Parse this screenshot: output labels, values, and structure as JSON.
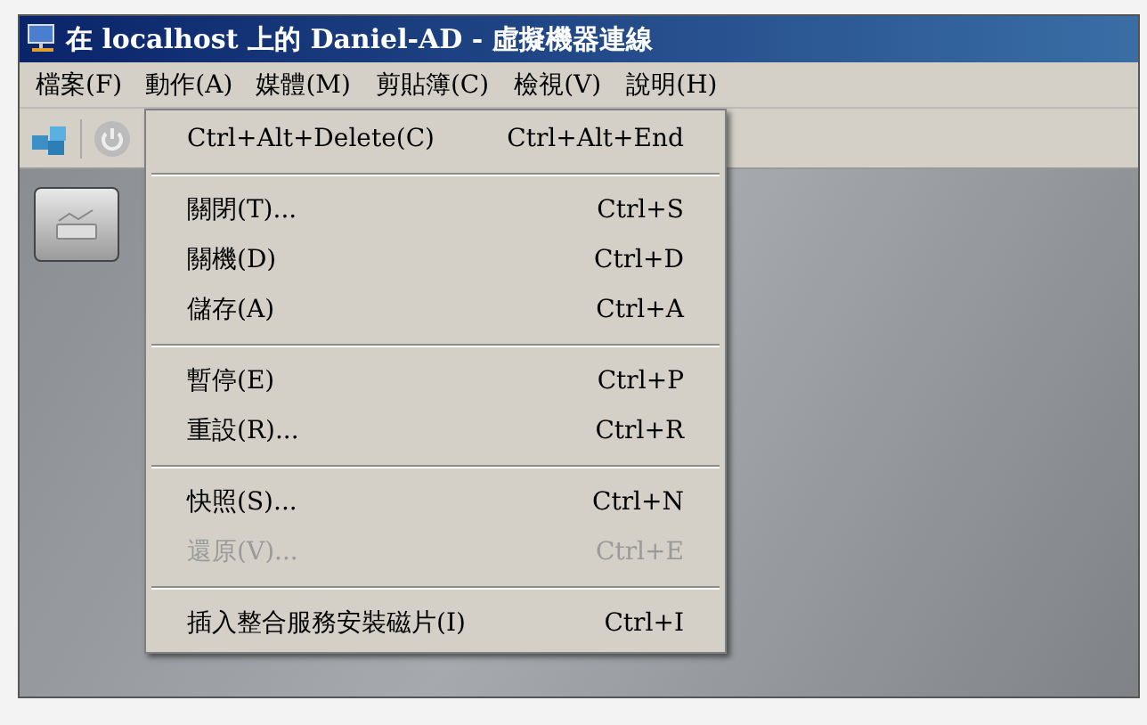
{
  "window": {
    "title": "在 localhost 上的 Daniel-AD - 虛擬機器連線"
  },
  "menu_bar": [
    {
      "label": "檔案(F)",
      "selected": false
    },
    {
      "label": "動作(A)",
      "selected": true
    },
    {
      "label": "媒體(M)",
      "selected": false
    },
    {
      "label": "剪貼簿(C)",
      "selected": false
    },
    {
      "label": "檢視(V)",
      "selected": false
    },
    {
      "label": "說明(H)",
      "selected": false
    }
  ],
  "dropdown": {
    "groups": [
      [
        {
          "label": "Ctrl+Alt+Delete(C)",
          "shortcut": "Ctrl+Alt+End",
          "disabled": false
        }
      ],
      [
        {
          "label": "關閉(T)...",
          "shortcut": "Ctrl+S",
          "disabled": false
        },
        {
          "label": "關機(D)",
          "shortcut": "Ctrl+D",
          "disabled": false
        },
        {
          "label": "儲存(A)",
          "shortcut": "Ctrl+A",
          "disabled": false
        }
      ],
      [
        {
          "label": "暫停(E)",
          "shortcut": "Ctrl+P",
          "disabled": false
        },
        {
          "label": "重設(R)...",
          "shortcut": "Ctrl+R",
          "disabled": false
        }
      ],
      [
        {
          "label": "快照(S)...",
          "shortcut": "Ctrl+N",
          "disabled": false
        },
        {
          "label": "還原(V)...",
          "shortcut": "Ctrl+E",
          "disabled": true
        }
      ],
      [
        {
          "label": "插入整合服務安裝磁片(I)",
          "shortcut": "Ctrl+I",
          "disabled": false
        }
      ]
    ]
  }
}
